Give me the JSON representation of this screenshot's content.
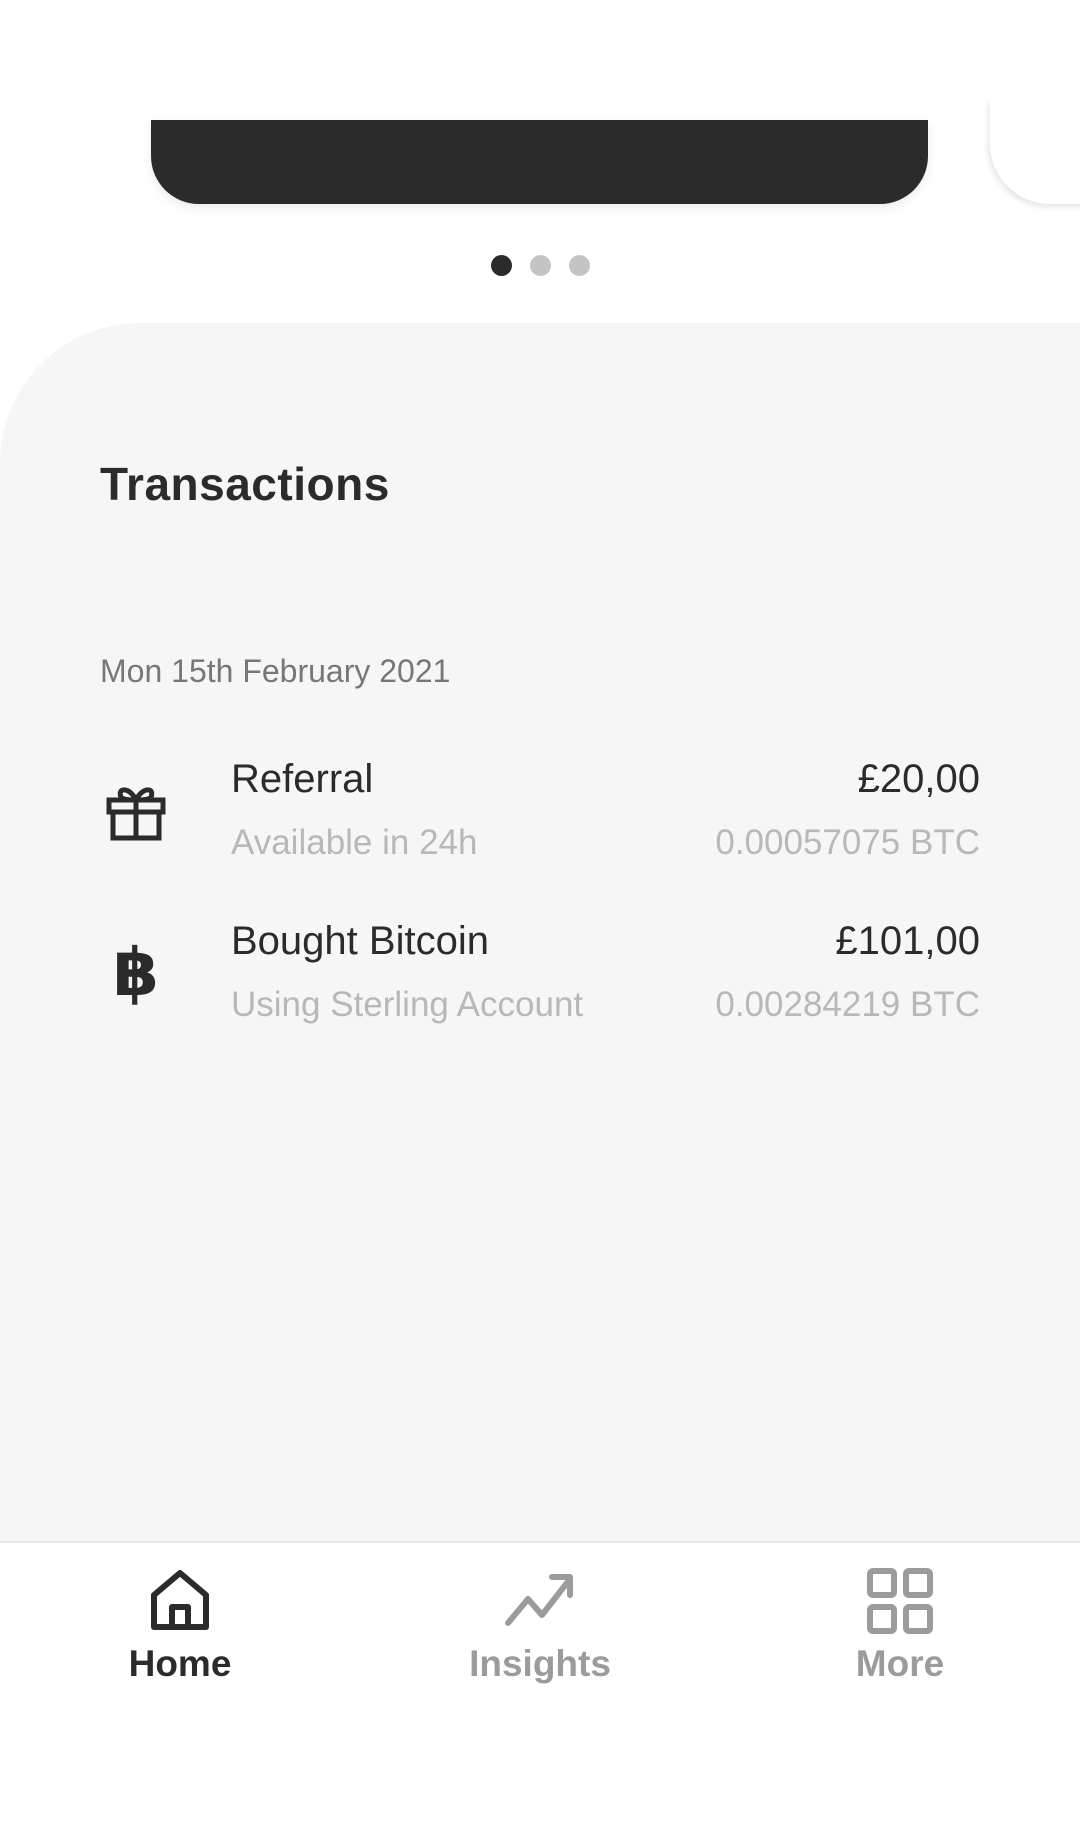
{
  "carousel": {
    "dot_count": 3,
    "active_index": 0
  },
  "transactions": {
    "title": "Transactions",
    "groups": [
      {
        "date": "Mon 15th February 2021",
        "items": [
          {
            "icon": "gift-icon",
            "name": "Referral",
            "subtitle": "Available in 24h",
            "amount": "£20,00",
            "btc": "0.00057075 BTC"
          },
          {
            "icon": "bitcoin-icon",
            "name": "Bought Bitcoin",
            "subtitle": "Using Sterling Account",
            "amount": "£101,00",
            "btc": "0.00284219 BTC"
          }
        ]
      }
    ]
  },
  "nav": {
    "items": [
      {
        "label": "Home",
        "icon": "home-icon",
        "active": true
      },
      {
        "label": "Insights",
        "icon": "trending-up-icon",
        "active": false
      },
      {
        "label": "More",
        "icon": "grid-icon",
        "active": false
      }
    ]
  },
  "colors": {
    "dark": "#2b2b2b",
    "sheet_bg": "#f6f6f6",
    "muted_text": "#b8b8b8",
    "inactive_nav": "#9b9b9b"
  }
}
